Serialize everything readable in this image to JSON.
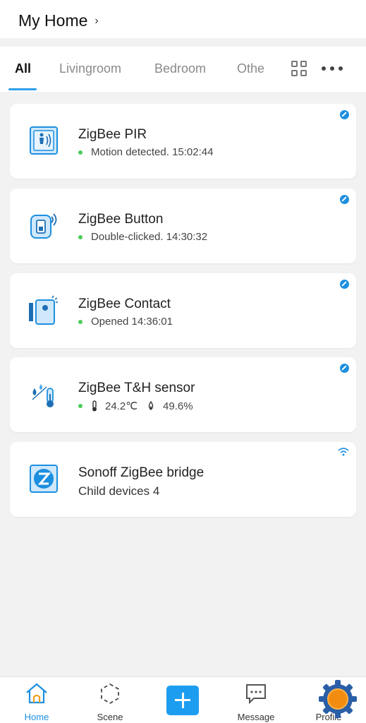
{
  "header": {
    "title": "My Home",
    "chevron": "›"
  },
  "tabs": {
    "items": [
      {
        "label": "All",
        "active": true
      },
      {
        "label": "Livingroom"
      },
      {
        "label": "Bedroom"
      },
      {
        "label": "Othe"
      }
    ],
    "grid_icon": "grid-view-icon",
    "more_icon": "more-options-icon"
  },
  "devices": [
    {
      "name": "ZigBee PIR",
      "status": "Motion detected. 15:02:44",
      "icon": "motion-sensor-icon",
      "badge": "edit-badge-icon"
    },
    {
      "name": "ZigBee Button",
      "status": "Double-clicked. 14:30:32",
      "icon": "wireless-button-icon",
      "badge": "edit-badge-icon"
    },
    {
      "name": "ZigBee Contact",
      "status": "Opened 14:36:01",
      "icon": "door-contact-icon",
      "badge": "edit-badge-icon"
    },
    {
      "name": "ZigBee T&H sensor",
      "temperature": "24.2℃",
      "humidity": "49.6%",
      "icon": "temperature-humidity-icon",
      "badge": "edit-badge-icon"
    },
    {
      "name": "Sonoff ZigBee bridge",
      "subtitle": "Child devices 4",
      "icon": "zigbee-bridge-icon",
      "badge": "wifi-icon"
    }
  ],
  "bottom_nav": {
    "items": [
      {
        "label": "Home",
        "active": true,
        "icon": "home-icon"
      },
      {
        "label": "Scene",
        "icon": "scene-icon"
      },
      {
        "label": "",
        "icon": "add-icon"
      },
      {
        "label": "Message",
        "icon": "message-icon"
      },
      {
        "label": "Profile",
        "icon": "profile-icon"
      }
    ]
  },
  "colors": {
    "accent": "#1d9df0",
    "online": "#4ccb5a",
    "background": "#f2f2f2"
  }
}
